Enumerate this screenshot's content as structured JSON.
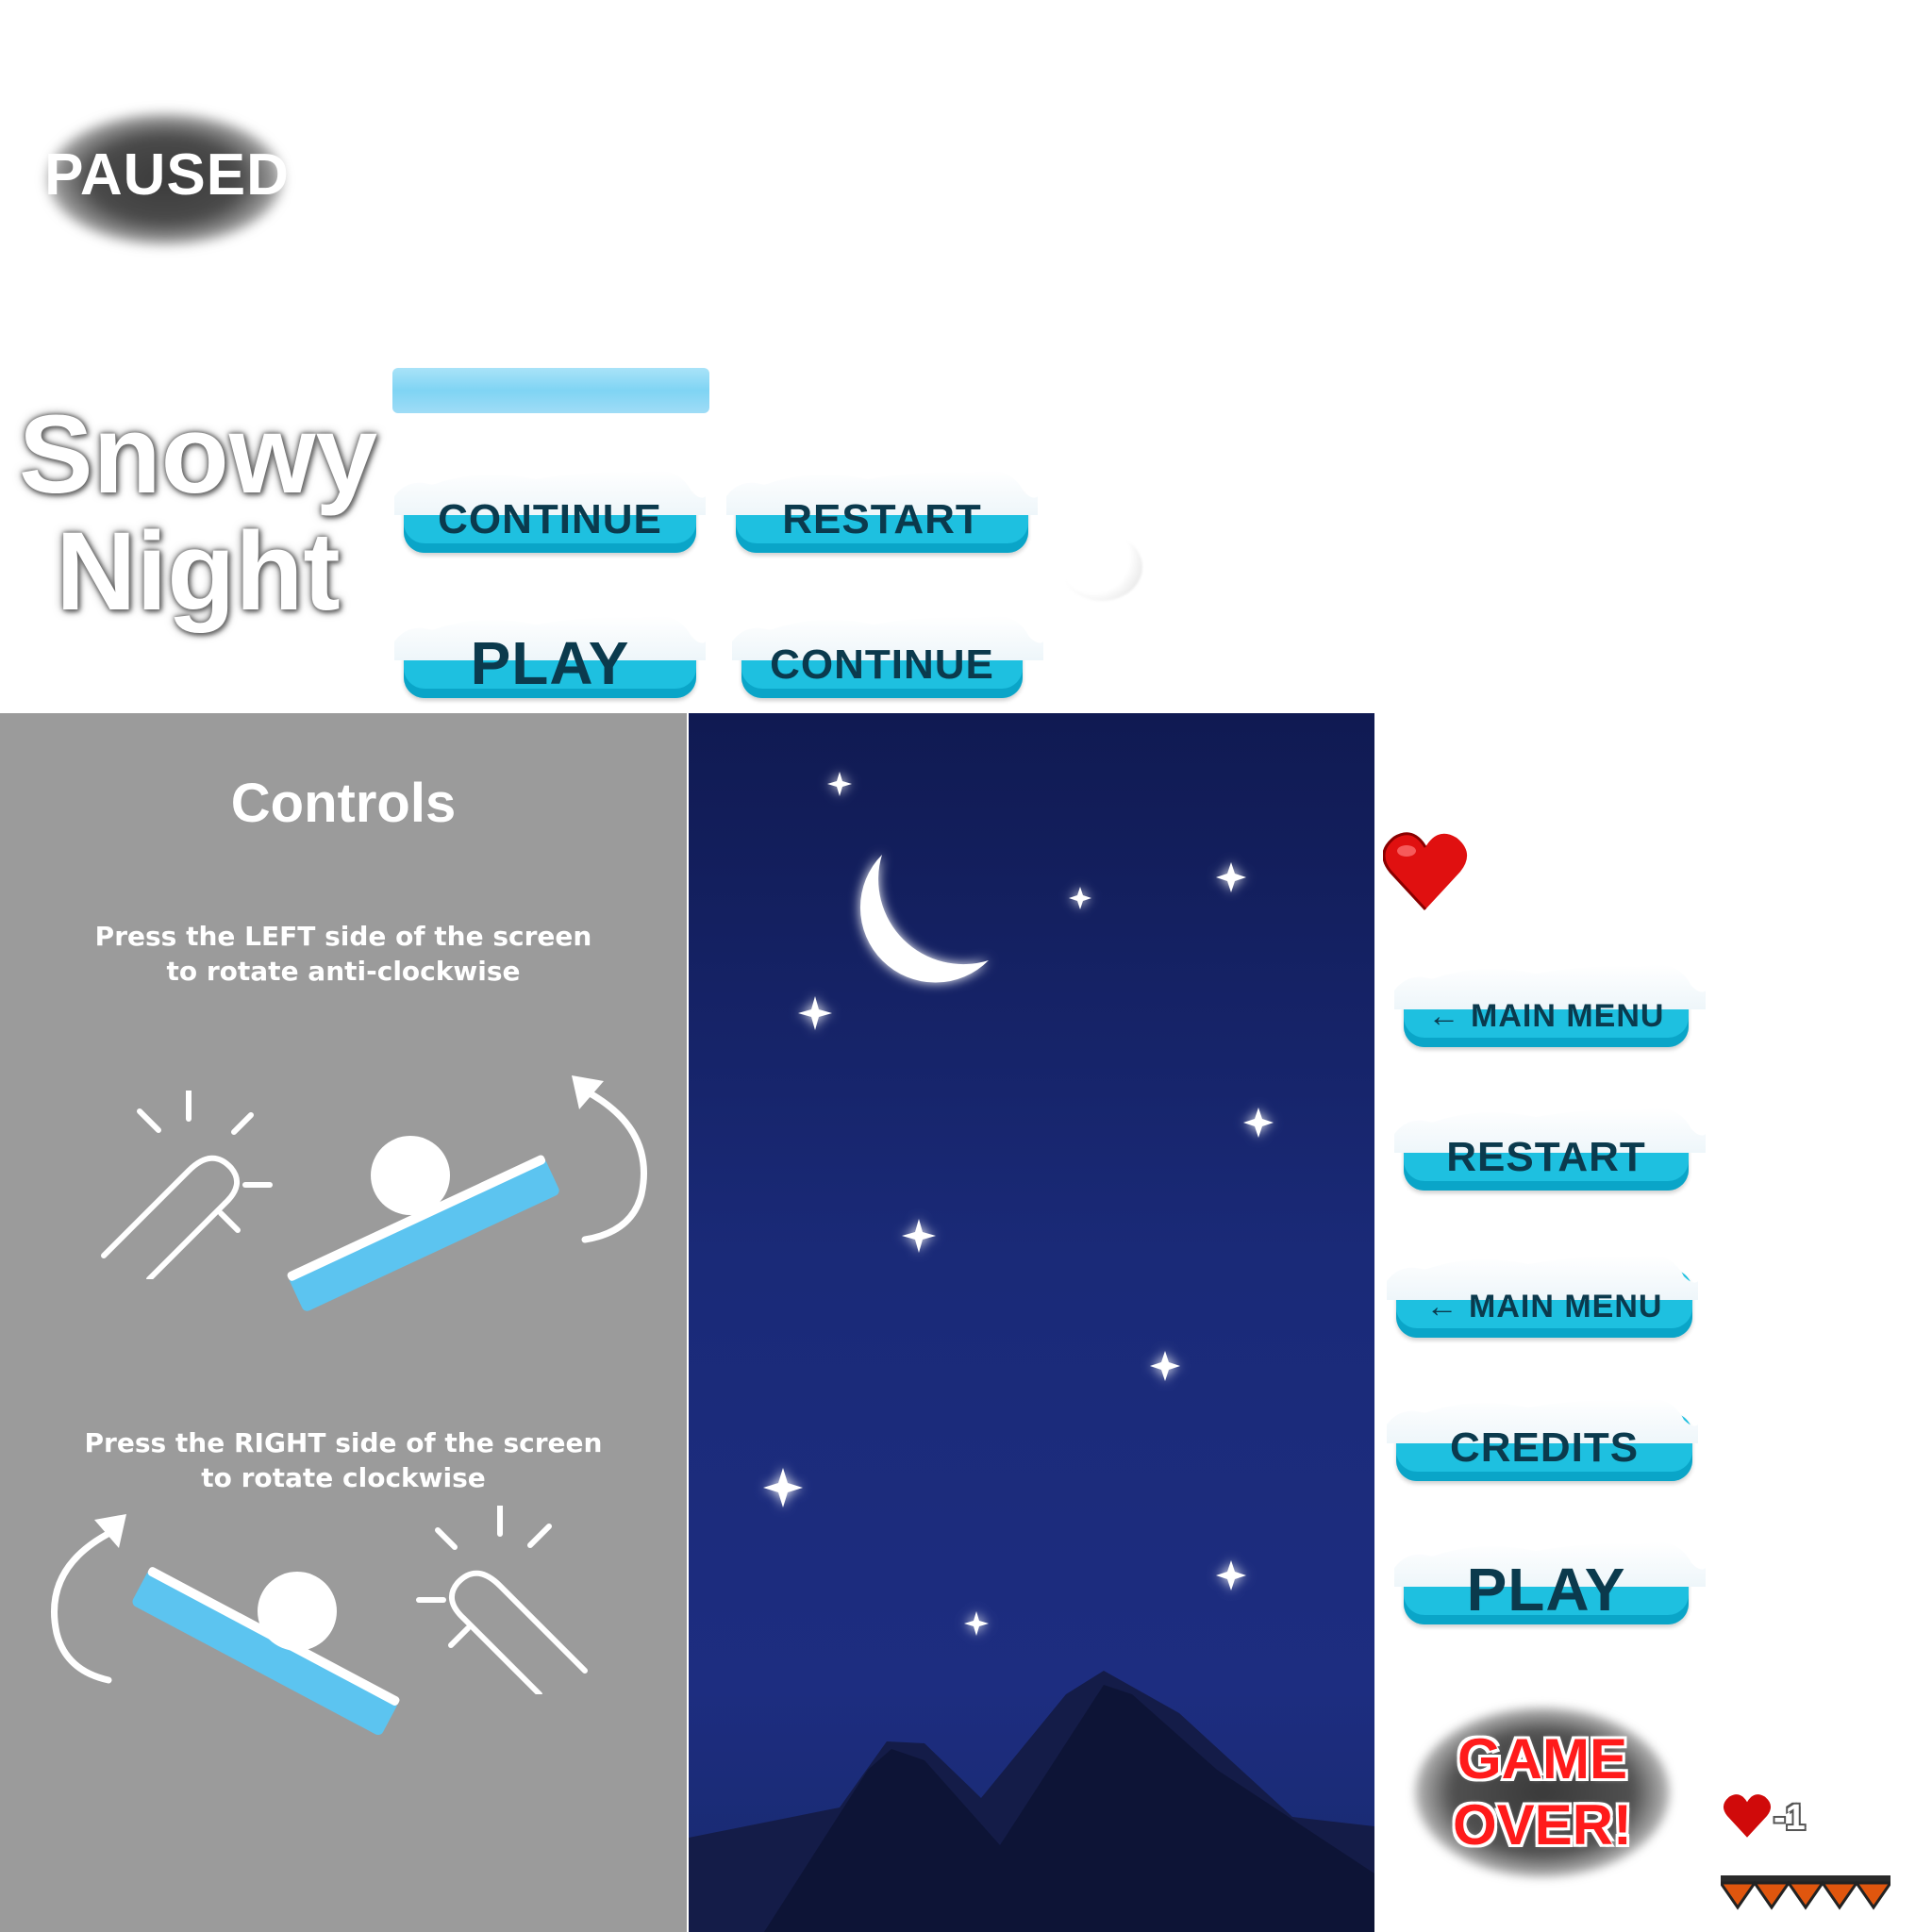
{
  "paused_label": "PAUSED",
  "title": {
    "line1": "Snowy",
    "line2": "Night"
  },
  "buttons_top": {
    "continue1": "CONTINUE",
    "restart1": "RESTART",
    "play1": "PLAY",
    "continue2": "CONTINUE"
  },
  "controls": {
    "title": "Controls",
    "left_line1": "Press the LEFT side of the screen",
    "left_line2": "to rotate anti-clockwise",
    "right_line1": "Press the RIGHT side of the screen",
    "right_line2": "to rotate clockwise"
  },
  "buttons_right": {
    "main_menu1": "← MAIN MENU",
    "restart": "RESTART",
    "main_menu2": "← MAIN MENU",
    "credits": "CREDITS",
    "play": "PLAY"
  },
  "game_over": {
    "line1": "GAME",
    "line2": "OVER!"
  },
  "life_change": "-1",
  "colors": {
    "button": "#1ec0e0",
    "button_text": "#0b3a4d",
    "sky": "#1a2a78",
    "heart": "#e01010",
    "game_over_text": "#ff1b1b",
    "controls_bg": "#9b9b9b"
  },
  "icons": [
    "heart-icon",
    "moon-icon",
    "star-icon",
    "tap-hand-icon",
    "rotate-arrow-icon",
    "snowball-icon",
    "life-lost-heart-icon",
    "lava-spikes-icon"
  ]
}
